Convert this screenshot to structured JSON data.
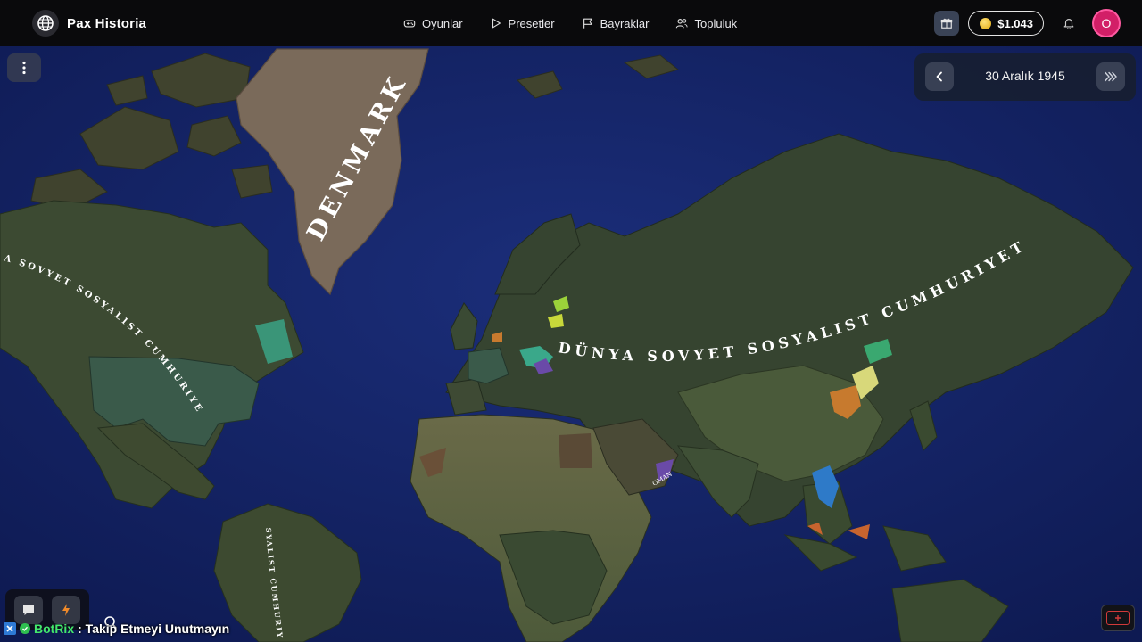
{
  "app": {
    "brand_name": "Pax Historia",
    "nav": [
      {
        "label": "Oyunlar",
        "icon": "gamepad-icon"
      },
      {
        "label": "Presetler",
        "icon": "play-icon"
      },
      {
        "label": "Bayraklar",
        "icon": "flag-icon"
      },
      {
        "label": "Topluluk",
        "icon": "users-icon"
      }
    ],
    "coins": "$1.043",
    "avatar_initial": "O"
  },
  "timeline": {
    "date": "30 Aralık 1945"
  },
  "map_labels": {
    "denmark": "DENMARK",
    "soviet_main": "DÜNYA SOVYET SOSYALIST CUMHURIYETI",
    "soviet_america": "A SOVYET SOSYALIST CUMHURIYETI",
    "soviet_south_america": "SYALIST CUMHURIYETI",
    "oman": "OMAN"
  },
  "chat_toast": {
    "bot_name": "BotRix",
    "message": ": Takip Etmeyi Unutmayın"
  },
  "colors": {
    "ocean": "#142466",
    "soviet_land": "#3a4a30",
    "denmark_land": "#7a6a5a",
    "accent_pink": "#d21f67"
  }
}
